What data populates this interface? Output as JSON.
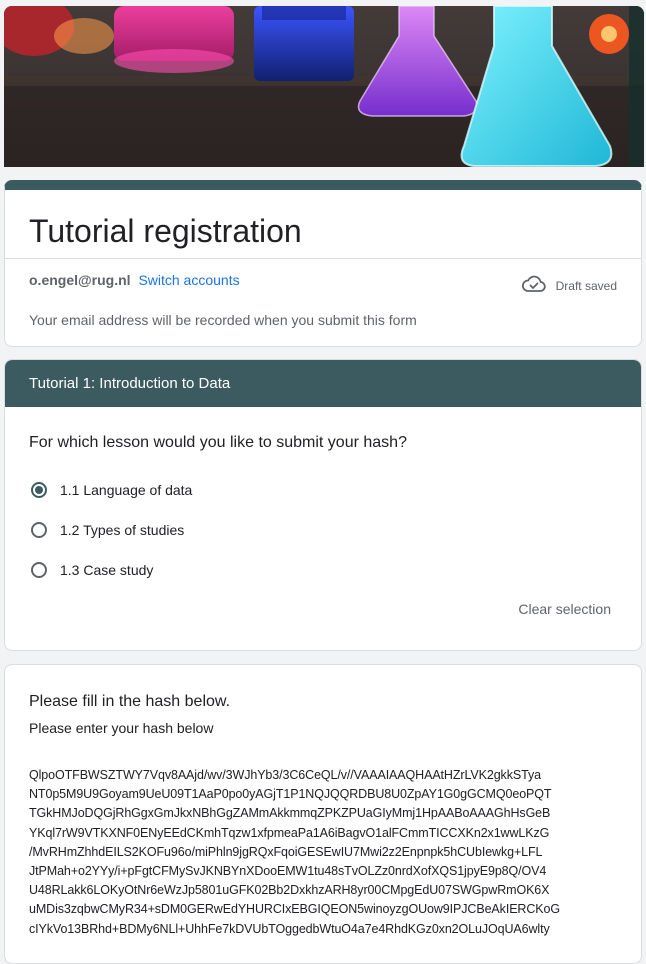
{
  "form": {
    "title": "Tutorial registration",
    "account_email": "o.engel@rug.nl",
    "switch_accounts": "Switch accounts",
    "draft_status": "Draft saved",
    "email_notice": "Your email address will be recorded when you submit this form"
  },
  "section": {
    "title": "Tutorial 1: Introduction to Data",
    "question": "For which lesson would you like to submit your hash?",
    "options": [
      {
        "label": "1.1 Language of data",
        "selected": true
      },
      {
        "label": "1.2 Types of studies",
        "selected": false
      },
      {
        "label": "1.3 Case study",
        "selected": false
      }
    ],
    "clear_selection": "Clear selection"
  },
  "hash_question": {
    "title": "Please fill in the hash below.",
    "description": "Please enter your hash below",
    "value": "QlpoOTFBWSZTWY7Vqv8AAjd/wv/3WJhYb3/3C6CeQL/v//VAAAIAAQHAAtHZrLVK2gkkSTya\nNT0p5M9U9Goyam9UeU09T1AaP0po0yAGjT1P1NQJQQRDBU8U0ZpAY1G0gGCMQ0eoPQT\nTGkHMJoDQGjRhGgxGmJkxNBhGgZAMmAkkmmqZPKZPUaGIyMmj1HpAABoAAAGhHsGeB\nYKql7rW9VTKXNF0ENyEEdCKmhTqzw1xfpmeaPa1A6iBagvO1alFCmmTICCXKn2x1wwLKzG\n/MvRHmZhhdEILS2KOFu96o/miPhln9jgRQxFqoiGESEwIU7Mwi2z2Enpnpk5hCUbIewkg+LFL\nJtPMah+o2YYy/i+pFgtCFMySvJKNBYnXDooEMW1tu48sTvOLZz0nrdXofXQS1jpyE9p8Q/OV4\nU48RLakk6LOKyOtNr6eWzJp5801uGFK02Bb2DxkhzARH8yr00CMpgEdU07SWGpwRmOK6X\nuMDis3zqbwCMyR34+sDM0GERwEdYHURCIxEBGIQEON5winoyzgOUow9IPJCBeAkIERCKoG\ncIYkVo13BRhd+BDMy6NLl+UhhFe7kDVUbTOggedbWtuO4a7e4RhdKGz0xn2OLuJOqUA6wlty"
  }
}
